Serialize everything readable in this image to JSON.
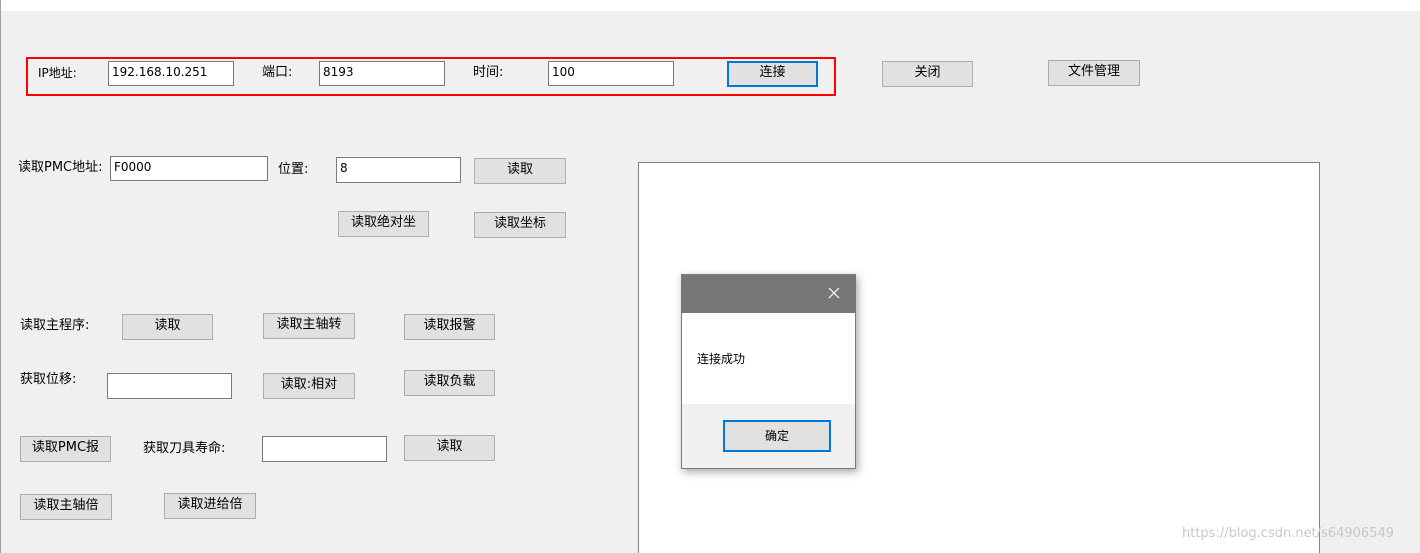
{
  "connection": {
    "ip_label": "IP地址:",
    "ip_value": "192.168.10.251",
    "port_label": "端口:",
    "port_value": "8193",
    "time_label": "时间:",
    "time_value": "100",
    "connect_button": "连接",
    "close_button": "关闭",
    "file_manage_button": "文件管理"
  },
  "pmc": {
    "address_label": "读取PMC地址:",
    "address_value": "F0000",
    "position_label": "位置:",
    "position_value": "8",
    "read_button": "读取",
    "read_absolute_button": "读取绝对坐",
    "read_coords_button": "读取坐标"
  },
  "main_program": {
    "label": "读取主程序:",
    "read_button": "读取",
    "read_spindle_speed_button": "读取主轴转",
    "read_alarm_button": "读取报警"
  },
  "displacement": {
    "label": "获取位移:",
    "value": "",
    "read_relative_button": "读取:相对",
    "read_load_button": "读取负载"
  },
  "tool_life": {
    "read_pmc_alarm_button": "读取PMC报",
    "label": "获取刀具寿命:",
    "value": "",
    "read_button": "读取"
  },
  "override": {
    "spindle_override_button": "读取主轴倍",
    "feed_override_button": "读取进给倍"
  },
  "dialog": {
    "message": "连接成功",
    "ok_button": "确定",
    "close_icon": "close-icon"
  },
  "watermark": "https://blog.csdn.net/s64906549",
  "colors": {
    "highlight_border": "#ff0000",
    "focus_border": "#0078d7",
    "dialog_titlebar": "#777777"
  }
}
